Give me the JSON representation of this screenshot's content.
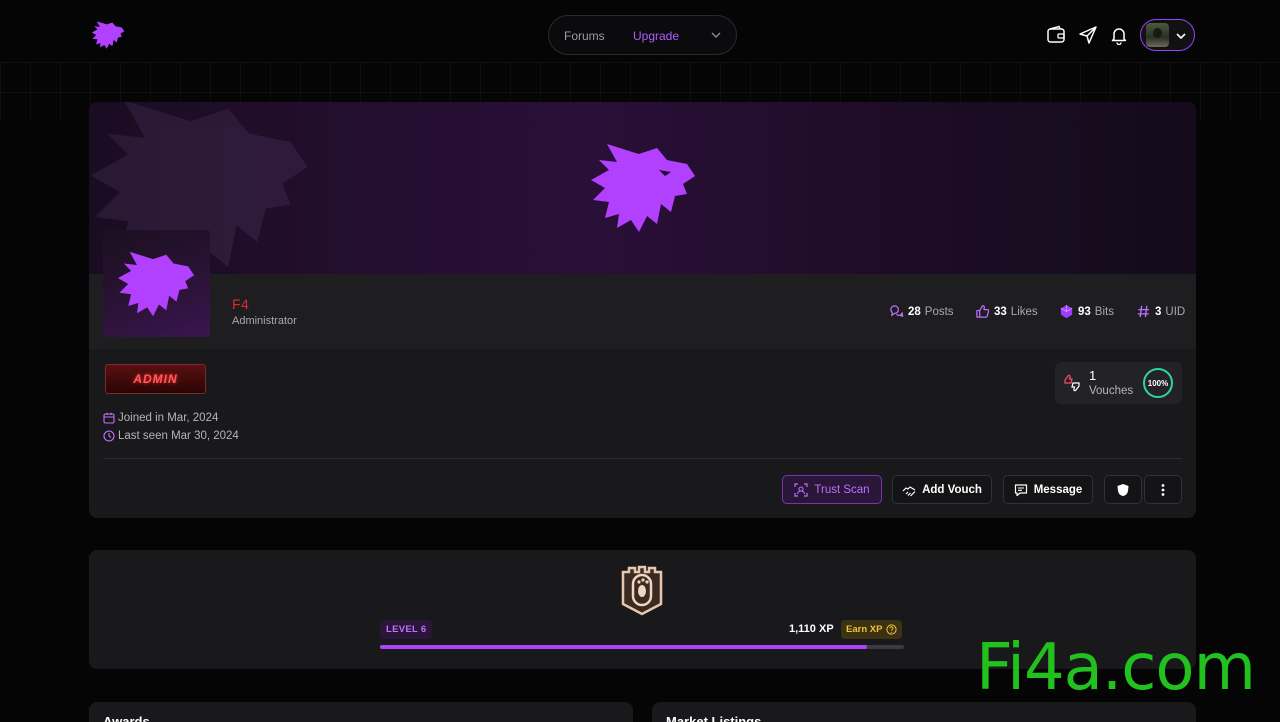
{
  "nav": {
    "forums": "Forums",
    "upgrade": "Upgrade"
  },
  "profile": {
    "username": "F4",
    "role": "Administrator",
    "stats": {
      "posts_value": "28",
      "posts_label": "Posts",
      "likes_value": "33",
      "likes_label": "Likes",
      "bits_value": "93",
      "bits_label": "Bits",
      "uid_value": "3",
      "uid_label": "UID"
    },
    "badge": "ADMIN",
    "joined": "Joined in Mar, 2024",
    "last_seen": "Last seen Mar 30, 2024",
    "vouches": {
      "count": "1",
      "label": "Vouches",
      "percent": "100%"
    },
    "actions": {
      "trust_scan": "Trust Scan",
      "add_vouch": "Add Vouch",
      "message": "Message"
    }
  },
  "level": {
    "label": "LEVEL 6",
    "xp": "1,110 XP",
    "earn": "Earn XP",
    "progress_fraction": 0.93
  },
  "sections": {
    "awards": "Awards",
    "market": "Market Listings"
  },
  "watermark": "Fi4a.com",
  "colors": {
    "accent": "#b140ff",
    "username": "#e02a2a",
    "vouch_ring": "#2fd3a1",
    "earn": "#f0c23a"
  }
}
